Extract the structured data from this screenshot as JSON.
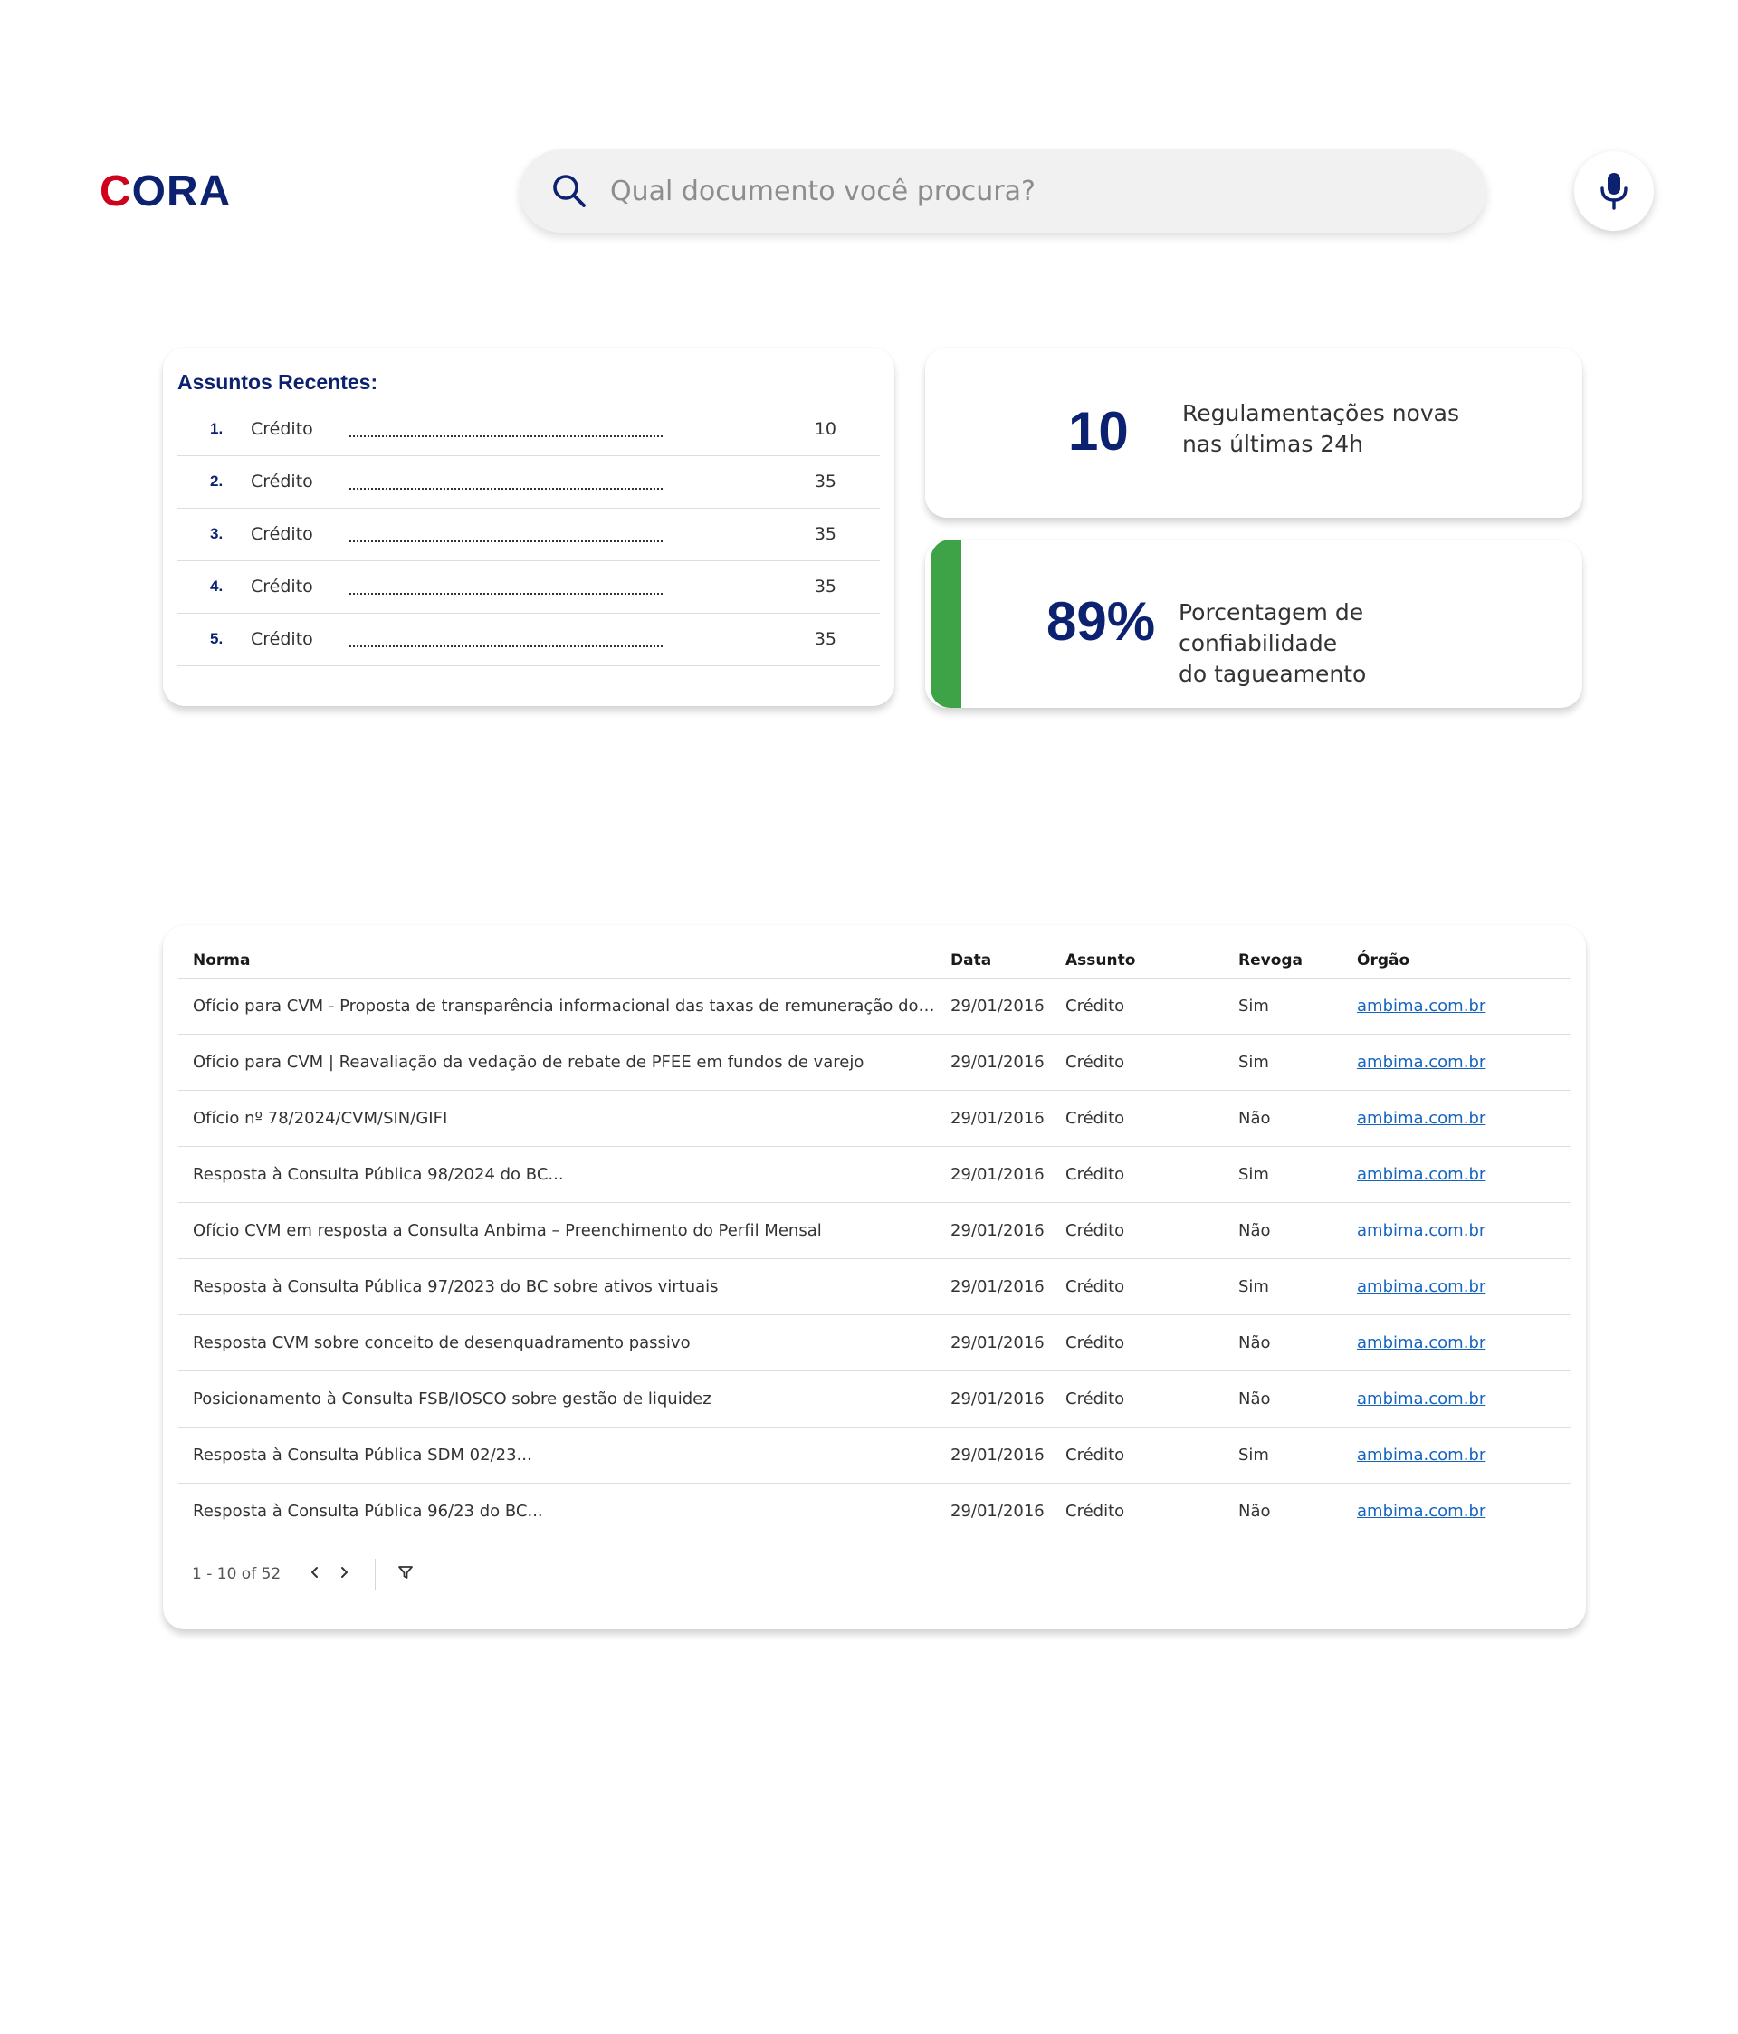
{
  "header": {
    "logo": {
      "first_letter": "C",
      "rest": "ORA"
    },
    "search": {
      "placeholder": "Qual documento você procura?",
      "value": ""
    },
    "icons": [
      "search-icon",
      "microphone-icon"
    ]
  },
  "recent_subjects": {
    "title": "Assuntos Recentes:",
    "items": [
      {
        "num": "1.",
        "label": "Crédito",
        "count": "10"
      },
      {
        "num": "2.",
        "label": "Crédito",
        "count": "35"
      },
      {
        "num": "3.",
        "label": "Crédito",
        "count": "35"
      },
      {
        "num": "4.",
        "label": "Crédito",
        "count": "35"
      },
      {
        "num": "5.",
        "label": "Crédito",
        "count": "35"
      }
    ]
  },
  "stats": [
    {
      "value": "10",
      "label_line1": "Regulamentações novas",
      "label_line2": "nas últimas 24h"
    },
    {
      "value": "89%",
      "label_line1": "Porcentagem de confiabilidade",
      "label_line2": "do tagueamento"
    }
  ],
  "table": {
    "columns": [
      "Norma",
      "Data",
      "Assunto",
      "Revoga",
      "Órgão"
    ],
    "rows": [
      {
        "norma": " Ofício para CVM - Proposta de transparência informacional das taxas de remuneração dos pre...",
        "data": "29/01/2016",
        "assunto": "Crédito",
        "revoga": "Sim",
        "orgao": "ambima.com.br"
      },
      {
        "norma": "Ofício para CVM | Reavaliação da vedação de rebate de PFEE em fundos de varejo",
        "data": "29/01/2016",
        "assunto": "Crédito",
        "revoga": "Sim",
        "orgao": "ambima.com.br"
      },
      {
        "norma": "Ofício nº 78/2024/CVM/SIN/GIFI",
        "data": "29/01/2016",
        "assunto": "Crédito",
        "revoga": "Não",
        "orgao": "ambima.com.br"
      },
      {
        "norma": "Resposta à Consulta Pública 98/2024 do BC...",
        "data": "29/01/2016",
        "assunto": "Crédito",
        "revoga": "Sim",
        "orgao": "ambima.com.br"
      },
      {
        "norma": "Ofício CVM em resposta a Consulta Anbima – Preenchimento do Perfil Mensal",
        "data": "29/01/2016",
        "assunto": "Crédito",
        "revoga": "Não",
        "orgao": "ambima.com.br"
      },
      {
        "norma": "Resposta à Consulta Pública 97/2023 do BC sobre ativos virtuais",
        "data": "29/01/2016",
        "assunto": "Crédito",
        "revoga": "Sim",
        "orgao": "ambima.com.br"
      },
      {
        "norma": "Resposta CVM sobre conceito de desenquadramento passivo",
        "data": "29/01/2016",
        "assunto": "Crédito",
        "revoga": "Não",
        "orgao": "ambima.com.br"
      },
      {
        "norma": "Posicionamento à Consulta FSB/IOSCO sobre gestão de liquidez",
        "data": "29/01/2016",
        "assunto": "Crédito",
        "revoga": "Não",
        "orgao": "ambima.com.br"
      },
      {
        "norma": "Resposta à Consulta Pública SDM 02/23...",
        "data": "29/01/2016",
        "assunto": "Crédito",
        "revoga": "Sim",
        "orgao": "ambima.com.br"
      },
      {
        "norma": "Resposta à Consulta Pública 96/23 do BC...",
        "data": "29/01/2016",
        "assunto": "Crédito",
        "revoga": "Não",
        "orgao": "ambima.com.br"
      }
    ],
    "pagination": {
      "range": "1 - 10",
      "total": "of 52",
      "icons": [
        "chevron-left-icon",
        "chevron-right-icon",
        "filter-icon"
      ]
    }
  },
  "colors": {
    "brand_navy": "#0c2271",
    "brand_red": "#d0021b",
    "accent_green": "#3ea247",
    "link_blue": "#1565c0"
  }
}
